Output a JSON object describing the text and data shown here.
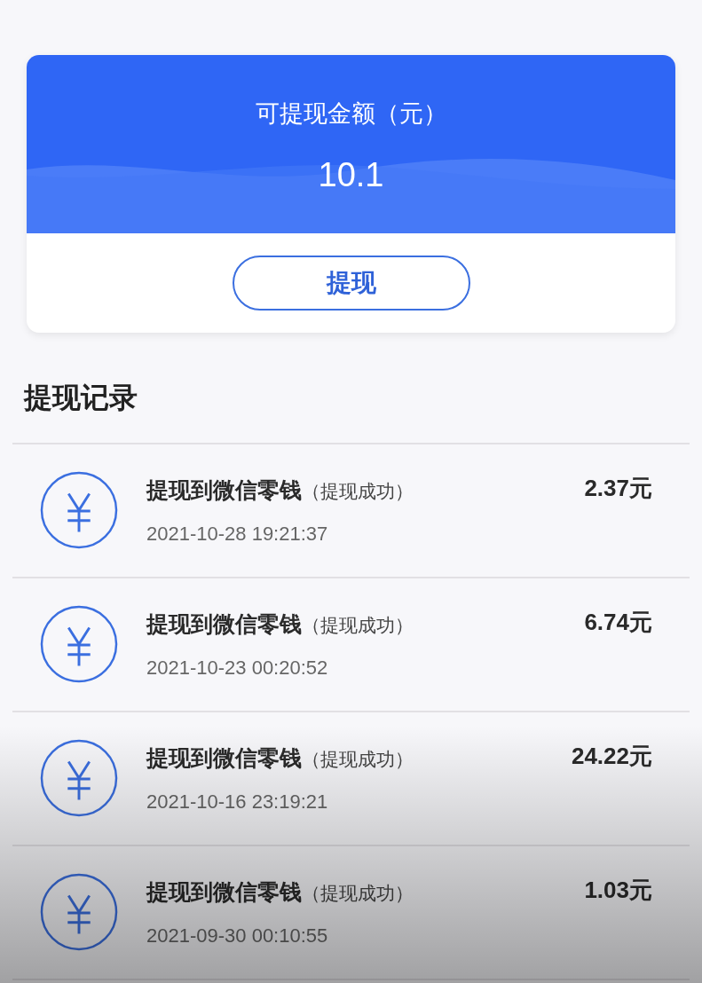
{
  "balance_card": {
    "label": "可提现金额（元）",
    "amount": "10.1",
    "button": "提现"
  },
  "records_title": "提现记录",
  "records": [
    {
      "title": "提现到微信零钱",
      "status": "（提现成功）",
      "time": "2021-10-28 19:21:37",
      "amount": "2.37元"
    },
    {
      "title": "提现到微信零钱",
      "status": "（提现成功）",
      "time": "2021-10-23 00:20:52",
      "amount": "6.74元"
    },
    {
      "title": "提现到微信零钱",
      "status": "（提现成功）",
      "time": "2021-10-16 23:19:21",
      "amount": "24.22元"
    },
    {
      "title": "提现到微信零钱",
      "status": "（提现成功）",
      "time": "2021-09-30 00:10:55",
      "amount": "1.03元"
    }
  ]
}
